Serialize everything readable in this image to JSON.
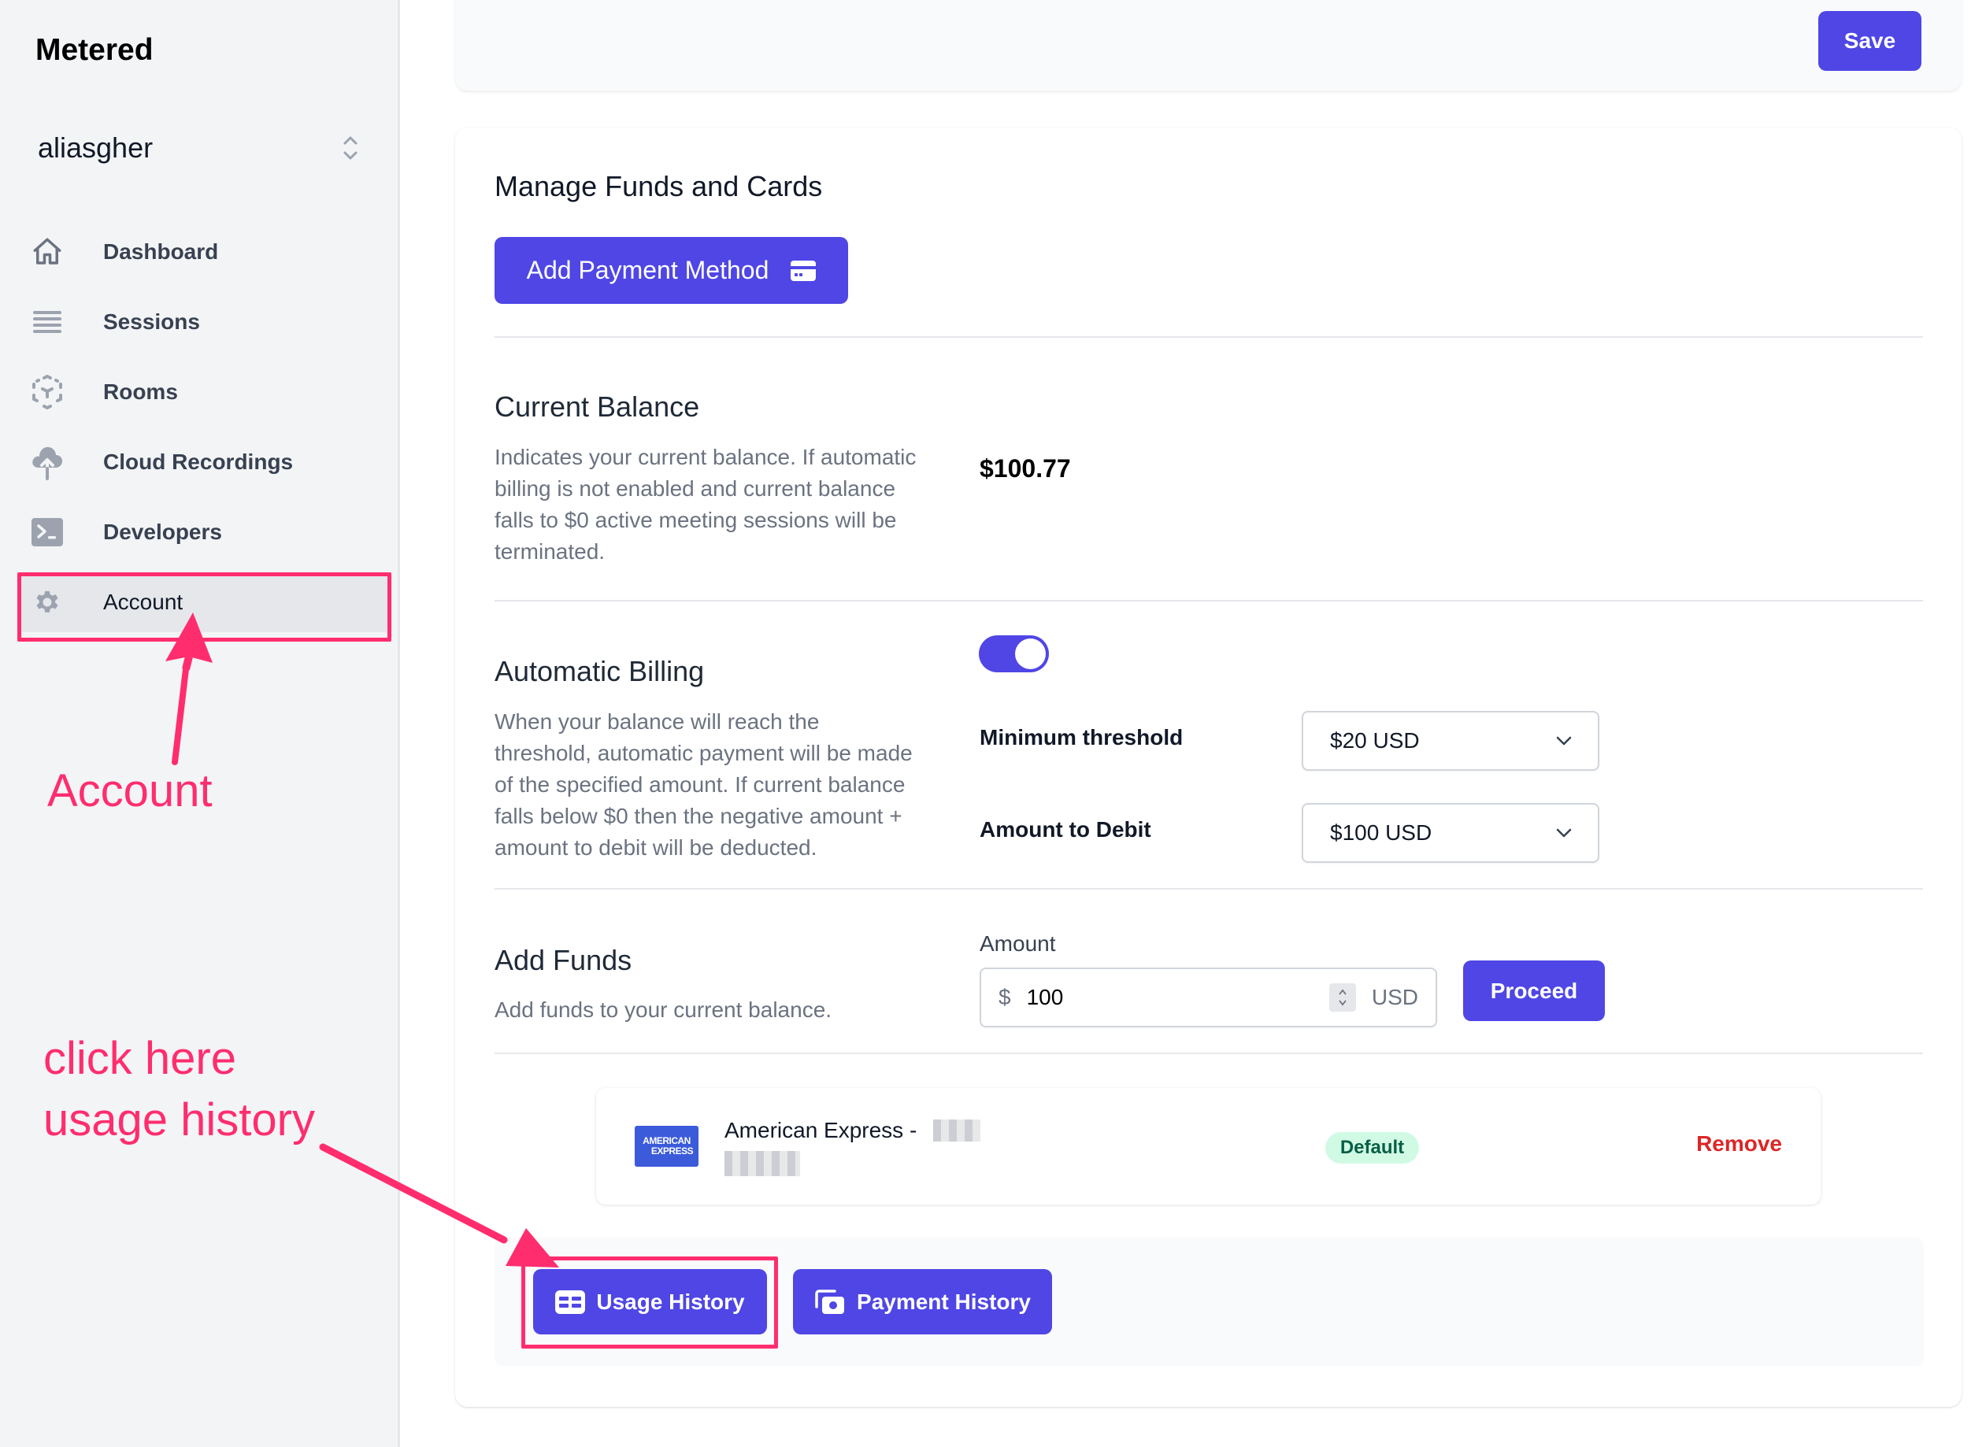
{
  "sidebar": {
    "brand": "Metered",
    "org_name": "aliasgher",
    "items": [
      {
        "label": "Dashboard",
        "icon": "home-icon"
      },
      {
        "label": "Sessions",
        "icon": "list-icon"
      },
      {
        "label": "Rooms",
        "icon": "cube-icon"
      },
      {
        "label": "Cloud Recordings",
        "icon": "cloud-upload-icon"
      },
      {
        "label": "Developers",
        "icon": "terminal-icon"
      },
      {
        "label": "Account",
        "icon": "gear-icon",
        "active": true
      }
    ]
  },
  "topbar": {
    "save_label": "Save"
  },
  "manage": {
    "title": "Manage Funds and Cards",
    "add_payment_label": "Add Payment Method"
  },
  "balance": {
    "title": "Current Balance",
    "desc_lines": [
      "Indicates your current balance. If automatic",
      "billing is not enabled and current balance",
      "falls to $0 active meeting sessions will be",
      "terminated."
    ],
    "value": "$100.77"
  },
  "auto_billing": {
    "title": "Automatic Billing",
    "enabled": true,
    "desc_lines": [
      "When your balance will reach the",
      "threshold, automatic payment will be made",
      "of the specified amount. If current balance",
      "falls below $0 then the negative amount +",
      "amount to debit will be deducted."
    ],
    "min_threshold_label": "Minimum threshold",
    "min_threshold_value": "$20 USD",
    "debit_label": "Amount to Debit",
    "debit_value": "$100 USD"
  },
  "add_funds": {
    "title": "Add Funds",
    "desc": "Add funds to your current balance.",
    "amount_label": "Amount",
    "prefix": "$",
    "value": "100",
    "suffix": "USD",
    "proceed_label": "Proceed"
  },
  "card": {
    "logo_line1": "AMERICAN",
    "logo_line2": "EXPRESS",
    "name": "American Express -",
    "badge": "Default",
    "remove_label": "Remove"
  },
  "history": {
    "usage_label": "Usage History",
    "payment_label": "Payment History"
  },
  "annotations": {
    "account_note": "Account",
    "usage_note_line1": "click here",
    "usage_note_line2": "usage history",
    "color": "#ff2d6e"
  },
  "colors": {
    "accent": "#4f46e5",
    "danger": "#dc2626",
    "success_bg": "#d1fae5",
    "success_text": "#065f46"
  }
}
